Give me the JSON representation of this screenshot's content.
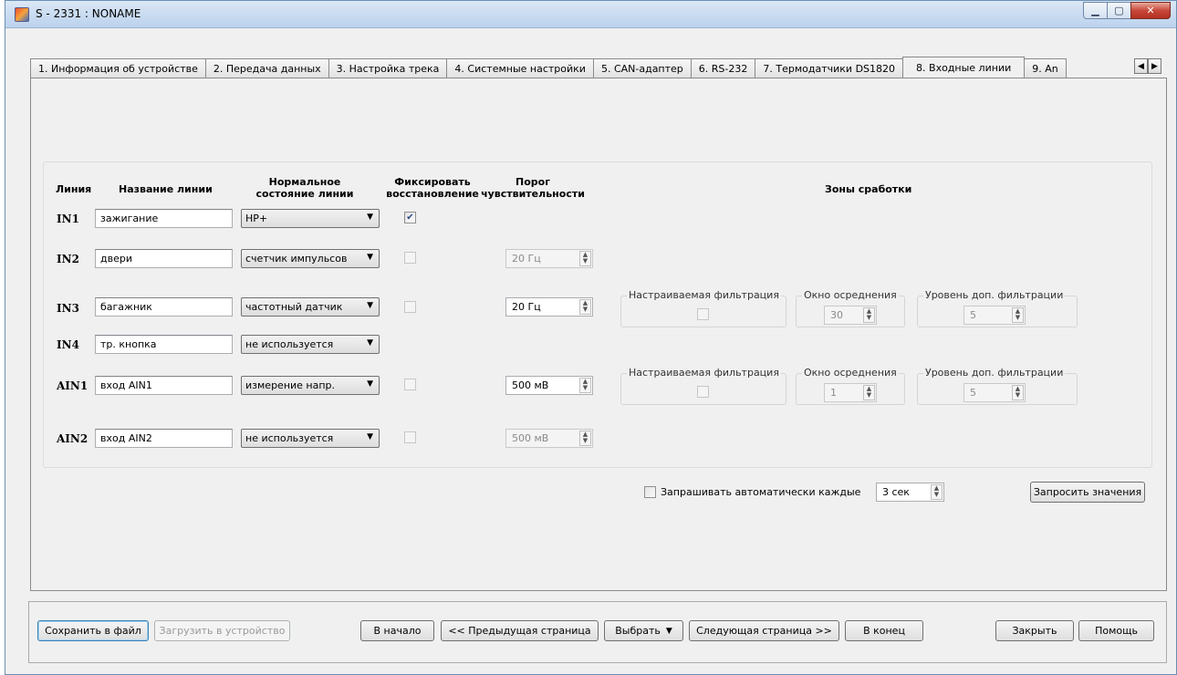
{
  "window": {
    "title": "S - 2331 : NONAME"
  },
  "tabs": [
    "1. Информация об устройстве",
    "2. Передача данных",
    "3. Настройка трека",
    "4. Системные настройки",
    "5. CAN-адаптер",
    "6. RS-232",
    "7. Термодатчики DS1820",
    "8. Входные линии",
    "9. An"
  ],
  "active_tab": "8. Входные линии",
  "headers": {
    "line": "Линия",
    "name": "Название линии",
    "normal_state_1": "Нормальное",
    "normal_state_2": "состояние линии",
    "fix_1": "Фиксировать",
    "fix_2": "восстановление",
    "threshold_1": "Порог",
    "threshold_2": "чувствительности",
    "zones": "Зоны сработки"
  },
  "lines": [
    {
      "id": "IN1",
      "name": "зажигание",
      "state": "НР+",
      "fix_checked": true,
      "fix_enabled": true
    },
    {
      "id": "IN2",
      "name": "двери",
      "state": "счетчик импульсов",
      "fix_checked": false,
      "fix_enabled": false,
      "threshold": "20 Гц",
      "threshold_enabled": false
    },
    {
      "id": "IN3",
      "name": "багажник",
      "state": "частотный датчик",
      "fix_checked": false,
      "fix_enabled": false,
      "threshold": "20 Гц",
      "threshold_enabled": true
    },
    {
      "id": "IN4",
      "name": "тр. кнопка",
      "state": "не используется"
    },
    {
      "id": "AIN1",
      "name": "вход AIN1",
      "state": "измерение напр.",
      "fix_checked": false,
      "fix_enabled": false,
      "threshold": "500 мВ",
      "threshold_enabled": true
    },
    {
      "id": "AIN2",
      "name": "вход AIN2",
      "state": "не используется",
      "fix_checked": false,
      "fix_enabled": false,
      "threshold": "500 мВ",
      "threshold_enabled": false
    }
  ],
  "filters": [
    {
      "custom_label": "Настраиваемая фильтрация",
      "window_label": "Окно осреднения",
      "window_value": "30",
      "level_label": "Уровень доп. фильтрации",
      "level_value": "5"
    },
    {
      "custom_label": "Настраиваемая фильтрация",
      "window_label": "Окно осреднения",
      "window_value": "1",
      "level_label": "Уровень доп. фильтрации",
      "level_value": "5"
    }
  ],
  "auto_request": {
    "label": "Запрашивать автоматически каждые",
    "interval": "3 сек",
    "checked": false
  },
  "request_button": "Запросить значения",
  "bottom": {
    "save_to_file": "Сохранить в файл",
    "load_to_device": "Загрузить в устройство",
    "to_start": "В начало",
    "prev_page": "<< Предыдущая страница",
    "select": "Выбрать",
    "next_page": "Следующая страница >>",
    "to_end": "В конец",
    "close": "Закрыть",
    "help": "Помощь"
  }
}
